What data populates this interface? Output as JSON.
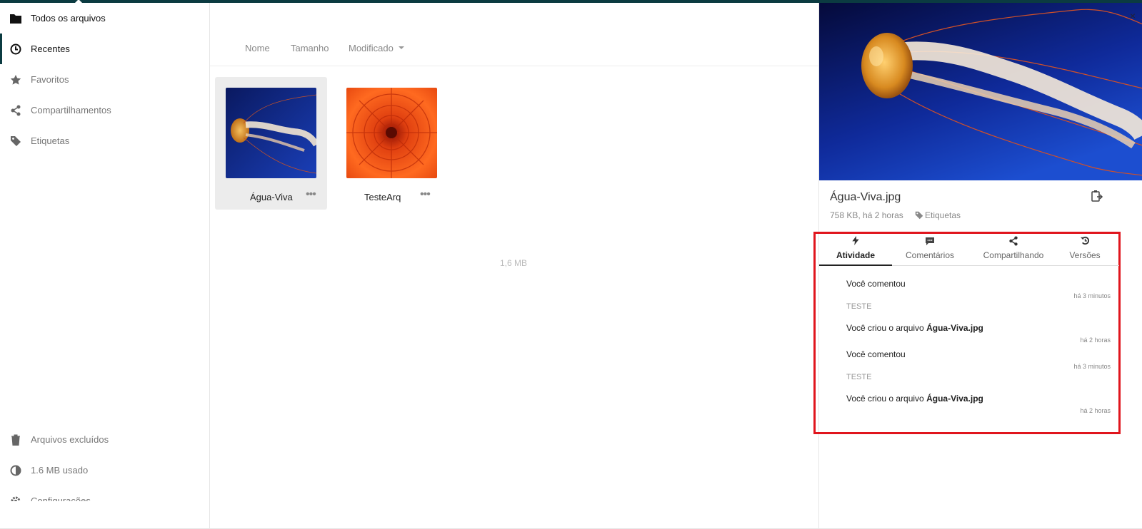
{
  "sidebar": {
    "items": [
      {
        "label": "Todos os arquivos",
        "icon": "folder-icon"
      },
      {
        "label": "Recentes",
        "icon": "clock-icon"
      },
      {
        "label": "Favoritos",
        "icon": "star-icon"
      },
      {
        "label": "Compartilhamentos",
        "icon": "share-icon"
      },
      {
        "label": "Etiquetas",
        "icon": "tag-icon"
      }
    ],
    "bottom": [
      {
        "label": "Arquivos excluídos",
        "icon": "trash-icon"
      },
      {
        "label": "1.6 MB usado",
        "icon": "pie-icon"
      },
      {
        "label": "Configurações",
        "icon": "gear-icon"
      }
    ]
  },
  "sort": {
    "name": "Nome",
    "size": "Tamanho",
    "modified": "Modificado"
  },
  "files": [
    {
      "name": "Água-Viva",
      "more": "•••",
      "thumb": "jellyfish"
    },
    {
      "name": "TesteArq",
      "more": "•••",
      "thumb": "flower"
    }
  ],
  "summary": "1,6 MB",
  "details": {
    "title": "Água-Viva.jpg",
    "meta": "758 KB, há 2 horas",
    "tags": "Etiquetas",
    "close": "×"
  },
  "tabs": [
    {
      "label": "Atividade",
      "icon": "bolt-icon",
      "active": true
    },
    {
      "label": "Comentários",
      "icon": "comment-icon"
    },
    {
      "label": "Compartilhando",
      "icon": "share-icon"
    },
    {
      "label": "Versões",
      "icon": "history-icon"
    }
  ],
  "activity": [
    {
      "text": "Você comentou",
      "time": "há 3 minutos",
      "comment": "TESTE"
    },
    {
      "text": "Você criou o arquivo ",
      "bold": "Água-Viva.jpg",
      "time": "há 2 horas"
    },
    {
      "text": "Você comentou",
      "time": "há 3 minutos",
      "comment": "TESTE"
    },
    {
      "text": "Você criou o arquivo ",
      "bold": "Água-Viva.jpg",
      "time": "há 2 horas"
    }
  ],
  "colors": {
    "accent": "#0b3b41",
    "highlight": "#e0151d"
  }
}
